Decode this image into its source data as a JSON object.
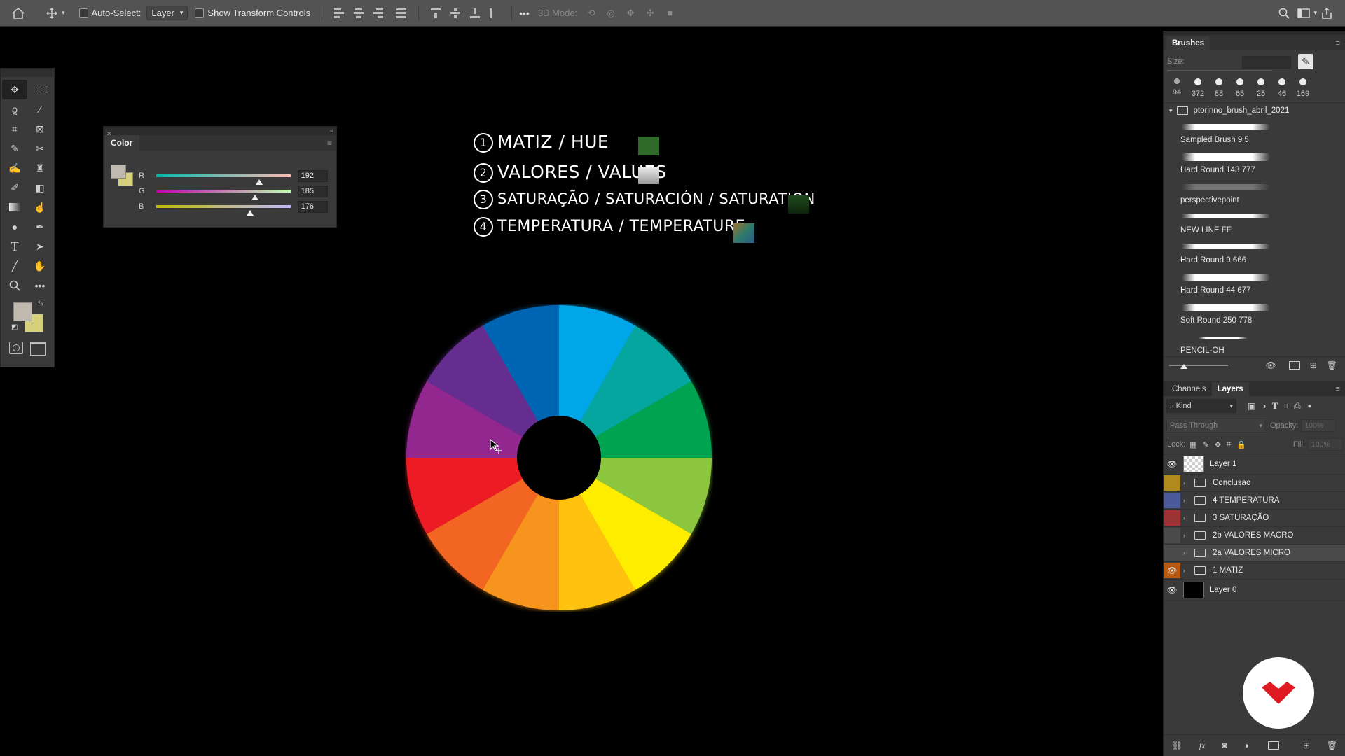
{
  "options_bar": {
    "auto_select_label": "Auto-Select:",
    "auto_select_value": "Layer",
    "show_transform_label": "Show Transform Controls",
    "mode_label": "3D Mode:",
    "more_label": "•••"
  },
  "color_panel": {
    "title": "Color",
    "channels": [
      {
        "label": "R",
        "value": "192",
        "fraction": 0.753
      },
      {
        "label": "G",
        "value": "185",
        "fraction": 0.725
      },
      {
        "label": "B",
        "value": "176",
        "fraction": 0.69
      }
    ],
    "foreground": "#c0b9b0",
    "background": "#d6cf7c"
  },
  "canvas": {
    "notes": [
      {
        "num": "1",
        "text": "MATIZ / HUE",
        "swatch": "#2f6a2a"
      },
      {
        "num": "2",
        "text": "VALORES / VALUES",
        "swatch": "#d0d0d0"
      },
      {
        "num": "3",
        "text": "SATURAÇÃO / SATURACIÓN / SATURATION",
        "swatch": "#1f4a1c"
      },
      {
        "num": "4",
        "text": "TEMPERATURA / TEMPERATURE",
        "swatch": "#4b7a55"
      }
    ],
    "wheel_colors": [
      "#00a7e8",
      "#06a6a0",
      "#00a34f",
      "#8cc63f",
      "#ffed00",
      "#ffc20e",
      "#f7941d",
      "#f26522",
      "#ed1c24",
      "#92278f",
      "#662d91",
      "#0066b3"
    ]
  },
  "brushes": {
    "title": "Brushes",
    "size_label": "Size:",
    "presets": [
      "94",
      "372",
      "88",
      "65",
      "25",
      "46",
      "169"
    ],
    "group_name": "ptorinno_brush_abril_2021",
    "items": [
      "Sampled Brush 9 5",
      "Hard Round 143 777",
      "perspectivepoint",
      "NEW LINE FF",
      "Hard Round 9 666",
      "Hard Round 44 677",
      "Soft Round 250 778",
      "PENCIL-OH"
    ]
  },
  "layers_panel": {
    "tabs": [
      "Channels",
      "Layers"
    ],
    "filter_label": "Kind",
    "blend_mode": "Pass Through",
    "opacity_label": "Opacity:",
    "opacity_value": "100%",
    "lock_label": "Lock:",
    "fill_label": "Fill:",
    "fill_value": "100%",
    "fx_label": "fx",
    "layers": [
      {
        "name": "Layer 1",
        "visible": true,
        "type": "layer",
        "tag": ""
      },
      {
        "name": "Conclusao",
        "visible": false,
        "type": "group",
        "tag": "#b08a1a"
      },
      {
        "name": "4 TEMPERATURA",
        "visible": false,
        "type": "group",
        "tag": "#4a5a9a"
      },
      {
        "name": "3 SATURAÇÃO",
        "visible": false,
        "type": "group",
        "tag": "#9a3434"
      },
      {
        "name": "2b VALORES MACRO",
        "visible": false,
        "type": "group",
        "tag": "#4a4a4a"
      },
      {
        "name": "2a VALORES MICRO",
        "visible": false,
        "type": "group",
        "tag": "#4a4a4a"
      },
      {
        "name": "1 MATIZ",
        "visible": true,
        "type": "group",
        "tag": "#b85a12"
      },
      {
        "name": "Layer 0",
        "visible": true,
        "type": "layer",
        "tag": ""
      }
    ]
  }
}
